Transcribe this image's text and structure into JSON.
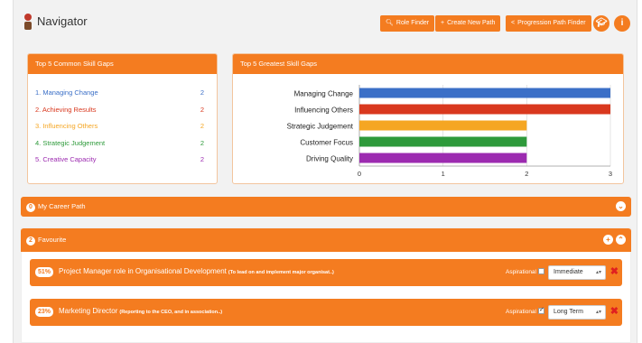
{
  "app": {
    "title": "Navigator"
  },
  "toolbar": {
    "role_finder": "Role Finder",
    "create_path": "Create New Path",
    "progression_finder": "Progression Path Finder"
  },
  "common_gaps": {
    "title": "Top 5 Common Skill Gaps",
    "items": [
      {
        "label": "1. Managing Change",
        "count": "2",
        "color": "#3b6fc7"
      },
      {
        "label": "2. Achieving Results",
        "count": "2",
        "color": "#d9381e"
      },
      {
        "label": "3. Influencing Others",
        "count": "2",
        "color": "#f5a623"
      },
      {
        "label": "4. Strategic Judgement",
        "count": "2",
        "color": "#2e9a3b"
      },
      {
        "label": "5. Creative Capacity",
        "count": "2",
        "color": "#9c2bb0"
      }
    ]
  },
  "greatest_gaps": {
    "title": "Top 5 Greatest Skill Gaps"
  },
  "chart_data": {
    "type": "bar",
    "orientation": "horizontal",
    "categories": [
      "Managing Change",
      "Influencing Others",
      "Strategic Judgement",
      "Customer Focus",
      "Driving Quality"
    ],
    "values": [
      3,
      3,
      2,
      2,
      2
    ],
    "colors": [
      "#3b6fc7",
      "#d9381e",
      "#f5a623",
      "#2e9a3b",
      "#9c2bb0"
    ],
    "xlim": [
      0,
      3
    ],
    "xticks": [
      "0",
      "1",
      "2",
      "3"
    ],
    "grid": true
  },
  "career_path": {
    "count": "0",
    "label": "My Career Path"
  },
  "favourite": {
    "count": "2",
    "label": "Favourite",
    "items": [
      {
        "percent": "51%",
        "title": "Project Manager role in Organisational Development",
        "subtitle": "(To lead on and implement major organisat..)",
        "aspirational_label": "Aspirational",
        "aspirational": false,
        "timeframe": "Immediate"
      },
      {
        "percent": "23%",
        "title": "Marketing Director",
        "subtitle": "(Reporting to the CEO, and in association..)",
        "aspirational_label": "Aspirational",
        "aspirational": true,
        "timeframe": "Long Term"
      }
    ]
  }
}
